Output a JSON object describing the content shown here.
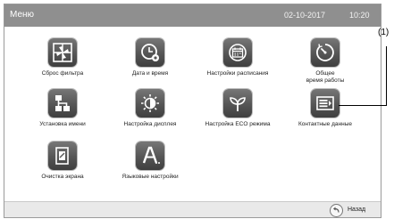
{
  "header": {
    "title": "Меню",
    "date": "02-10-2017",
    "time": "10:20"
  },
  "menu": {
    "filter_reset": "Сброс фильтра",
    "date_time": "Дата и время",
    "schedule_settings": "Настройки расписания",
    "total_runtime_line1": "Общее",
    "total_runtime_line2": "время работы",
    "name_setup": "Установка имени",
    "display_settings": "Настройка дисплея",
    "eco_settings": "Настройка ECO режима",
    "contact_data": "Контактные данные",
    "screen_cleaning": "Очистка экрана",
    "language_settings": "Языковые настройки"
  },
  "footer": {
    "back_label": "Назад"
  },
  "callout": {
    "label": "(1)"
  }
}
